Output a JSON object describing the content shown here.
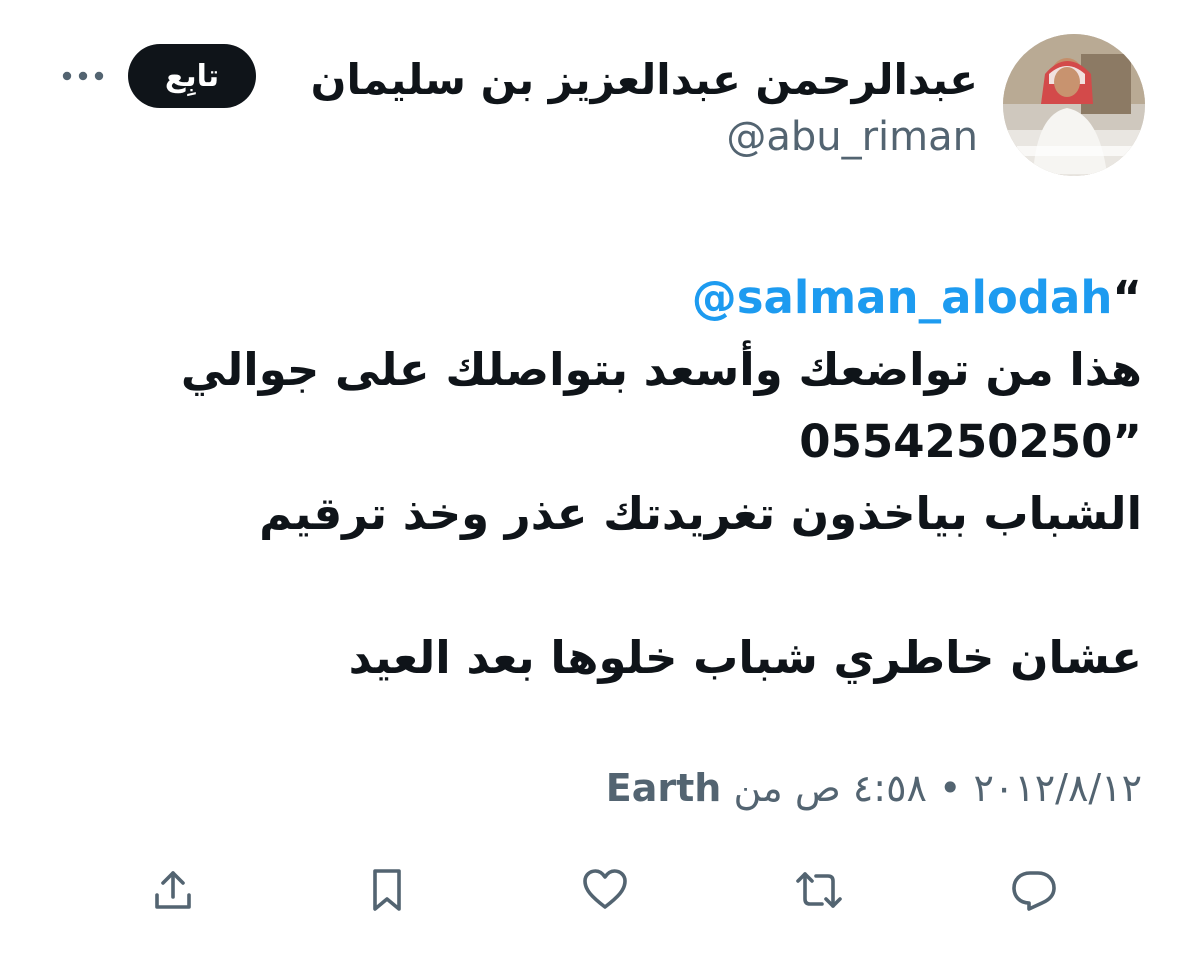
{
  "author": {
    "display_name": "عبدالرحمن عبدالعزيز بن سليمان",
    "handle": "@abu_riman",
    "avatar_icon": "avatar-photo"
  },
  "header": {
    "follow_label": "تابِع",
    "more_icon": "more-horizontal-icon"
  },
  "tweet": {
    "open_quote": "“",
    "mention": "@salman_alodah",
    "line2": "هذا من تواضعك وأسعد بتواصلك على جوالي",
    "phone": "0554250250",
    "close_quote": "”",
    "line4": "الشباب بياخذون تغريدتك عذر وخذ ترقيم",
    "line6": "عشان خاطري شباب خلوها بعد العيد"
  },
  "meta": {
    "date": "٢٠١٢/٨/١٢",
    "separator": "•",
    "time": "٤:٥٨ ص",
    "from_label": "من",
    "source": "Earth"
  },
  "actions": {
    "reply_icon": "reply-icon",
    "retweet_icon": "retweet-icon",
    "like_icon": "heart-icon",
    "bookmark_icon": "bookmark-icon",
    "share_icon": "share-icon"
  },
  "colors": {
    "text": "#0f1419",
    "secondary": "#536471",
    "link": "#1d9bf0",
    "follow_bg": "#0f1419"
  }
}
